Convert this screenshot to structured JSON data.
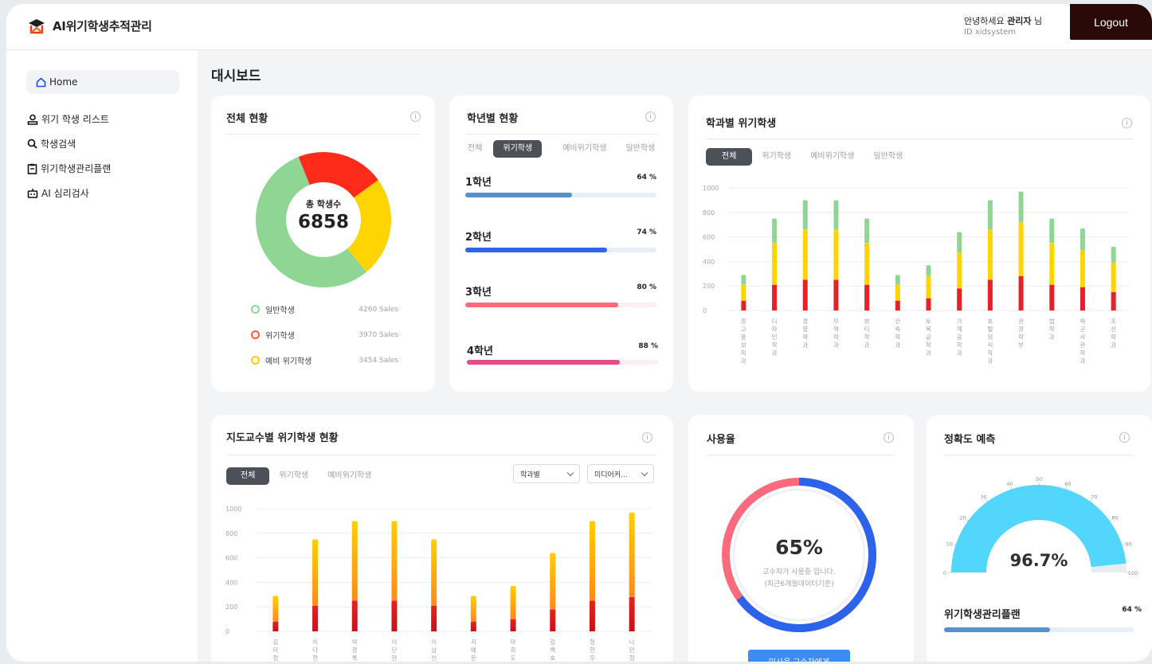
{
  "app": {
    "title": "AI위기학생추적관리"
  },
  "user": {
    "greeting": "안녕하세요",
    "name": "관리자",
    "suffix": "님",
    "id_label": "ID xidsystem"
  },
  "header": {
    "logout_label": "Logout"
  },
  "sidebar": {
    "items": [
      {
        "label": "Home",
        "icon": "home-icon",
        "active": true
      },
      {
        "label": "위기 학생 리스트",
        "icon": "user-icon"
      },
      {
        "label": "학생검색",
        "icon": "search-icon"
      },
      {
        "label": "위기학생관리플랜",
        "icon": "clipboard-icon"
      },
      {
        "label": "AI 심리검사",
        "icon": "robot-icon"
      }
    ]
  },
  "main": {
    "title": "대시보드"
  },
  "overall": {
    "title": "전체 현황",
    "center_label": "총 학생수",
    "total": "6858",
    "legend": [
      {
        "label": "일반학생",
        "value": "4260 Sales",
        "color": "#8fd694"
      },
      {
        "label": "위기학생",
        "value": "3970 Sales",
        "color": "#ff2b1a"
      },
      {
        "label": "예비 위기학생",
        "value": "3454 Sales",
        "color": "#ffd400"
      }
    ],
    "donut_fractions": [
      0.55,
      0.21,
      0.24
    ]
  },
  "by_grade": {
    "title": "학년별 현황",
    "tabs": [
      "전체",
      "위기학생",
      "예비위기학생",
      "일반학생"
    ],
    "active_tab": 1,
    "grades": [
      {
        "name": "1학년",
        "pct_label": "64 %",
        "pct": 0.56,
        "color": "#5b8fcc",
        "track": "#e8eef8"
      },
      {
        "name": "2학년",
        "pct_label": "74 %",
        "pct": 0.74,
        "color": "#2f63e8",
        "track": "#e8eef8"
      },
      {
        "name": "3학년",
        "pct_label": "80 %",
        "pct": 0.8,
        "color": "#ff6b7a",
        "track": "#fdeef0"
      },
      {
        "name": "4학년",
        "pct_label": "88 %",
        "pct": 0.8,
        "color": "#e64b86",
        "track": "#fdeef0"
      }
    ]
  },
  "by_dept": {
    "title": "학과별 위기학생",
    "tabs": [
      "전체",
      "위기학생",
      "예비위기학생",
      "일반학생"
    ],
    "active_tab": 0
  },
  "by_advisor": {
    "title": "지도교수별 위기학생 현황",
    "tabs": [
      "전체",
      "위기학생",
      "예비위기학생"
    ],
    "active_tab": 0,
    "select1": "학과별",
    "select2": "미디어커..."
  },
  "usage": {
    "title": "사용율",
    "percent_label": "65%",
    "percent": 0.65,
    "line1": "교수자가 사용중 입니다.",
    "line2": "(최근6개월데이터기준)",
    "button_label": "미사용 교수자에게"
  },
  "accuracy": {
    "title": "정확도 예측",
    "value_label": "96.7%",
    "value": 0.967,
    "ticks": [
      "0",
      "10",
      "20",
      "30",
      "40",
      "50",
      "60",
      "70",
      "80",
      "90",
      "100"
    ],
    "plan_label": "위기학생관리플랜",
    "plan_pct_label": "64 %",
    "plan_pct": 0.56
  },
  "chart_data": [
    {
      "type": "bar",
      "title": "학과별 위기학생",
      "categories": [
        "광고홍보학과",
        "디자인학과",
        "경영학과",
        "무역학과",
        "뷰티학과",
        "건축학과",
        "토목공학과",
        "가계공학과",
        "호텔외식학과",
        "관광학부",
        "법학과",
        "해군사관학과",
        "조선학과"
      ],
      "series": [
        {
          "name": "위기학생",
          "values": [
            80,
            210,
            250,
            250,
            210,
            80,
            100,
            180,
            250,
            280,
            210,
            190,
            150
          ],
          "color": "#e8202a"
        },
        {
          "name": "예비위기학생",
          "values": [
            130,
            340,
            410,
            410,
            340,
            130,
            180,
            290,
            410,
            440,
            340,
            300,
            240
          ],
          "color": "#ffd400"
        },
        {
          "name": "일반학생",
          "values": [
            80,
            200,
            240,
            240,
            200,
            80,
            90,
            170,
            240,
            250,
            200,
            180,
            130
          ],
          "color": "#8fd694"
        }
      ],
      "yticks": [
        "0",
        "200",
        "400",
        "600",
        "800",
        "1000"
      ],
      "ylim": [
        0,
        1000
      ],
      "stacked": true,
      "grid": true
    },
    {
      "type": "bar",
      "title": "지도교수별 위기학생 현황",
      "categories": [
        "김미정",
        "이다현",
        "박광록",
        "이단현",
        "이남선",
        "지예은",
        "마희도",
        "강백호",
        "정한우",
        "나민정"
      ],
      "series": [
        {
          "name": "위기학생",
          "values": [
            80,
            210,
            250,
            250,
            210,
            80,
            100,
            180,
            250,
            280
          ],
          "color": "#e8202a"
        },
        {
          "name": "예비위기학생",
          "values": [
            210,
            540,
            650,
            650,
            540,
            210,
            270,
            460,
            650,
            690
          ],
          "color": "#ffc400"
        }
      ],
      "yticks": [
        "0",
        "200",
        "400",
        "600",
        "800",
        "1000"
      ],
      "ylim": [
        0,
        1000
      ],
      "stacked": true,
      "grid": true
    }
  ]
}
